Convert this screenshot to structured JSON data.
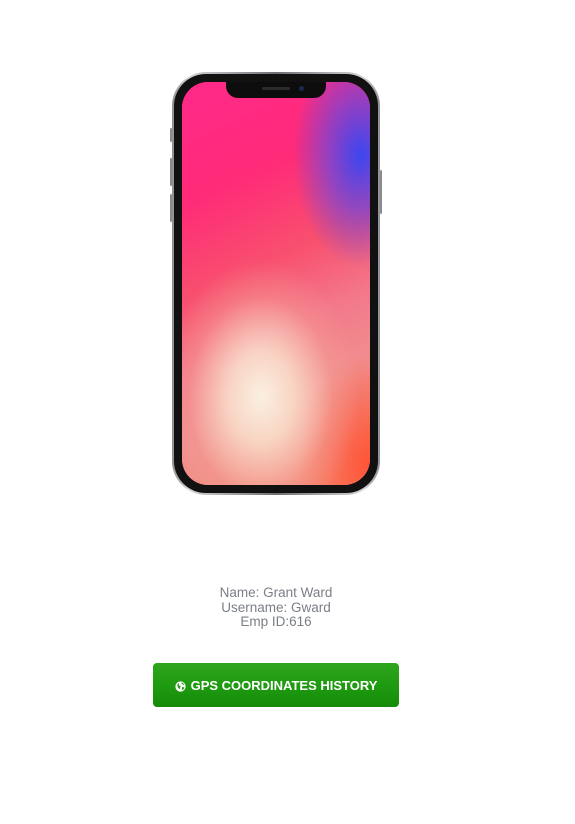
{
  "user": {
    "name_line": "Name: Grant Ward",
    "username_line": "Username: Gward",
    "emp_line": "Emp ID:616"
  },
  "actions": {
    "gps_history_label": "GPS COORDINATES HISTORY"
  },
  "icons": {
    "gps_button_icon": "globe-icon"
  },
  "colors": {
    "button_green": "#1e9a10",
    "info_text": "#7a7f86"
  }
}
